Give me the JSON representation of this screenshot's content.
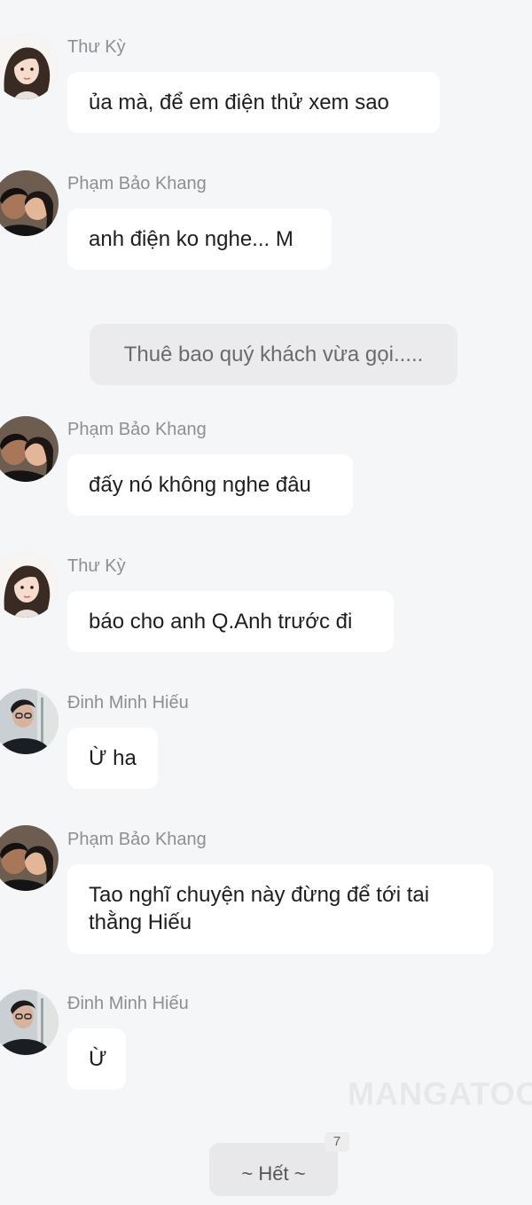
{
  "messages": [
    {
      "sender": "Thư Kỳ",
      "avatar": "girl-illustration-avatar",
      "text": "ủa mà, để em điện thử xem sao"
    },
    {
      "sender": "Phạm Bảo Khang",
      "avatar": "couple-photo-avatar",
      "text": "anh điện ko nghe... M"
    },
    {
      "system": "Thuê bao quý khách vừa gọi....."
    },
    {
      "sender": "Phạm Bảo Khang",
      "avatar": "couple-photo-avatar",
      "text": "đấy nó không nghe đâu"
    },
    {
      "sender": "Thư Kỳ",
      "avatar": "girl-illustration-avatar",
      "text": "báo cho anh Q.Anh trước đi"
    },
    {
      "sender": "Đinh Minh Hiếu",
      "avatar": "boy-glasses-avatar",
      "text": "Ừ ha"
    },
    {
      "sender": "Phạm Bảo Khang",
      "avatar": "couple-photo-avatar",
      "text": "Tao nghĩ chuyện này đừng để tới tai thằng Hiếu"
    },
    {
      "sender": "Đinh Minh Hiếu",
      "avatar": "boy-glasses-avatar",
      "text": "Ừ"
    }
  ],
  "end_label": "~ Hết ~",
  "badge": "7",
  "watermark": "MANGATOON"
}
